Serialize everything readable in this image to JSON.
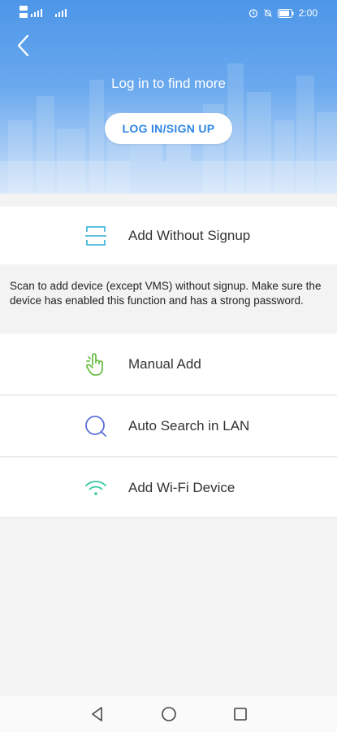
{
  "status_bar": {
    "time": "2:00",
    "icons": [
      "signal-icon",
      "signal-icon",
      "alarm-icon",
      "mute-icon",
      "battery-icon"
    ]
  },
  "header": {
    "back_icon": "chevron-left-icon",
    "prompt": "Log in to find more",
    "login_label": "LOG IN/SIGN UP"
  },
  "add_without_signup": {
    "icon": "scan-frame-icon",
    "label": "Add Without Signup",
    "hint": "Scan to add device (except VMS) without signup. Make sure the device has enabled this function and has a strong password."
  },
  "options": [
    {
      "icon": "hand-pointer-icon",
      "label": "Manual Add",
      "color": "#6cc04a"
    },
    {
      "icon": "search-circle-icon",
      "label": "Auto Search in LAN",
      "color": "#5a6fd8"
    },
    {
      "icon": "wifi-icon",
      "label": "Add Wi-Fi Device",
      "color": "#3cc8a0"
    }
  ],
  "colors": {
    "header_blue": "#4d96e8",
    "login_text": "#2f86e6",
    "scan_icon": "#47b8d8"
  },
  "nav_bar": {
    "back": "nav-back-icon",
    "home": "nav-home-icon",
    "recents": "nav-recents-icon"
  }
}
